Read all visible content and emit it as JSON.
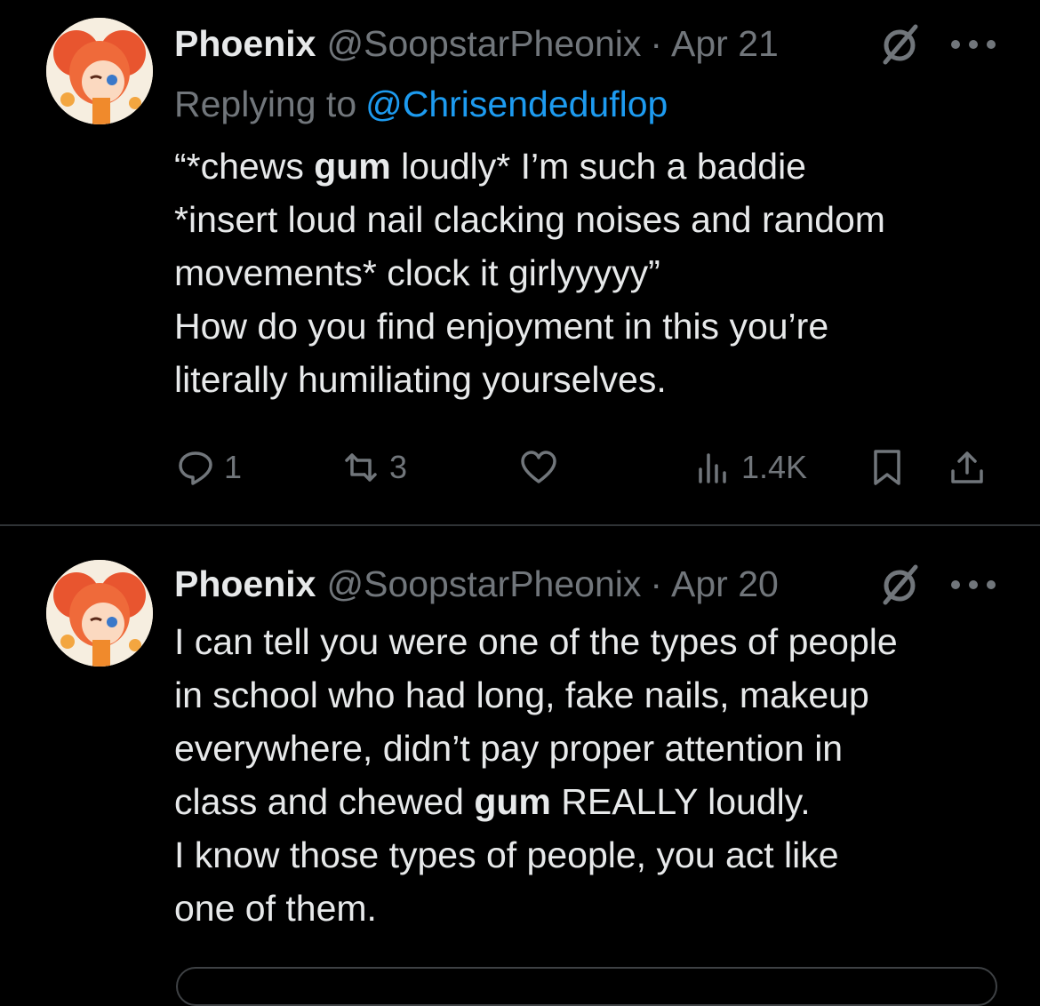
{
  "tweets": [
    {
      "author_name": "Phoenix",
      "handle": "@SoopstarPheonix",
      "separator": "·",
      "date": "Apr 21",
      "replying_prefix": "Replying to",
      "replying_to": "@Chrisendeduflop",
      "body_lines": [
        [
          {
            "t": "“*chews "
          },
          {
            "t": "gum",
            "b": true
          },
          {
            "t": " loudly* I’m such a baddie"
          }
        ],
        [
          {
            "t": "*insert loud nail clacking noises and random"
          }
        ],
        [
          {
            "t": "movements* clock it girlyyyyy”"
          }
        ],
        [
          {
            "t": "How do you find enjoyment in this you’re"
          }
        ],
        [
          {
            "t": "literally humiliating yourselves."
          }
        ]
      ],
      "actions": {
        "replies": "1",
        "retweets": "3",
        "views": "1.4K"
      }
    },
    {
      "author_name": "Phoenix",
      "handle": "@SoopstarPheonix",
      "separator": "·",
      "date": "Apr 20",
      "body_lines": [
        [
          {
            "t": "I can tell you were one of the types of people"
          }
        ],
        [
          {
            "t": "in school who had long, fake nails, makeup"
          }
        ],
        [
          {
            "t": "everywhere, didn’t pay proper attention in"
          }
        ],
        [
          {
            "t": "class and chewed "
          },
          {
            "t": "gum",
            "b": true
          },
          {
            "t": " REALLY loudly."
          }
        ],
        [
          {
            "t": "I know those types of people, you act like"
          }
        ],
        [
          {
            "t": "one of them."
          }
        ]
      ]
    }
  ],
  "icons": {
    "reply": "reply-icon",
    "retweet": "retweet-icon",
    "like": "heart-icon",
    "views": "views-icon",
    "bookmark": "bookmark-icon",
    "share": "share-icon",
    "grok": "grok-icon",
    "more": "more-icon"
  },
  "colors": {
    "background": "#000000",
    "text": "#e7e9ea",
    "muted": "#71767b",
    "link": "#1d9bf0",
    "divider": "#2f3336"
  }
}
